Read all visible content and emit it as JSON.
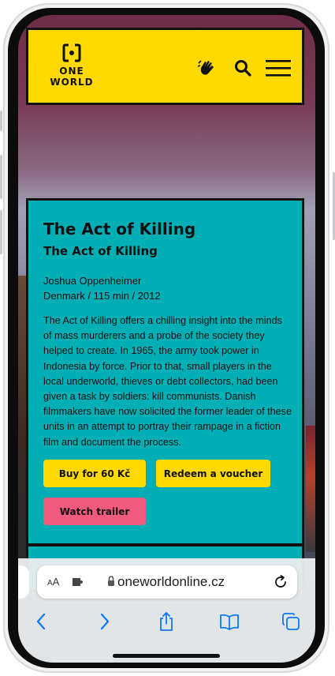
{
  "header": {
    "logo_line1": "ONE",
    "logo_line2": "WORLD",
    "icons": [
      "hand-wave-icon",
      "search-icon",
      "hamburger-menu-icon"
    ]
  },
  "film": {
    "title": "The Act of Killing",
    "original_title": "The Act of Killing",
    "director": "Joshua Oppenheimer",
    "details": "Denmark / 115 min / 2012",
    "description": "The Act of Killing offers a chilling insight into the minds of mass murderers and a probe of the society they helped to create. In 1965, the army took power in Indonesia by force. Prior to that, small players in the local underworld, thieves or debt collectors, had been given a task by soldiers: kill communists. Danish filmmakers have now solicited the former leader of these units in an attempt to portray their rampage in a fiction film and document the process.",
    "buttons": {
      "buy": "Buy for 60 Kč",
      "redeem": "Redeem a voucher",
      "trailer": "Watch trailer"
    }
  },
  "browser": {
    "text_size_label_small": "A",
    "text_size_label_large": "A",
    "url": "oneworldonline.cz",
    "toolbar_icons": [
      "back-icon",
      "forward-icon",
      "share-icon",
      "bookmarks-icon",
      "tabs-icon"
    ]
  },
  "colors": {
    "brand_yellow": "#ffd900",
    "card_teal": "#00afb5",
    "trailer_pink": "#f05a7e",
    "safari_blue": "#0a7aff"
  }
}
